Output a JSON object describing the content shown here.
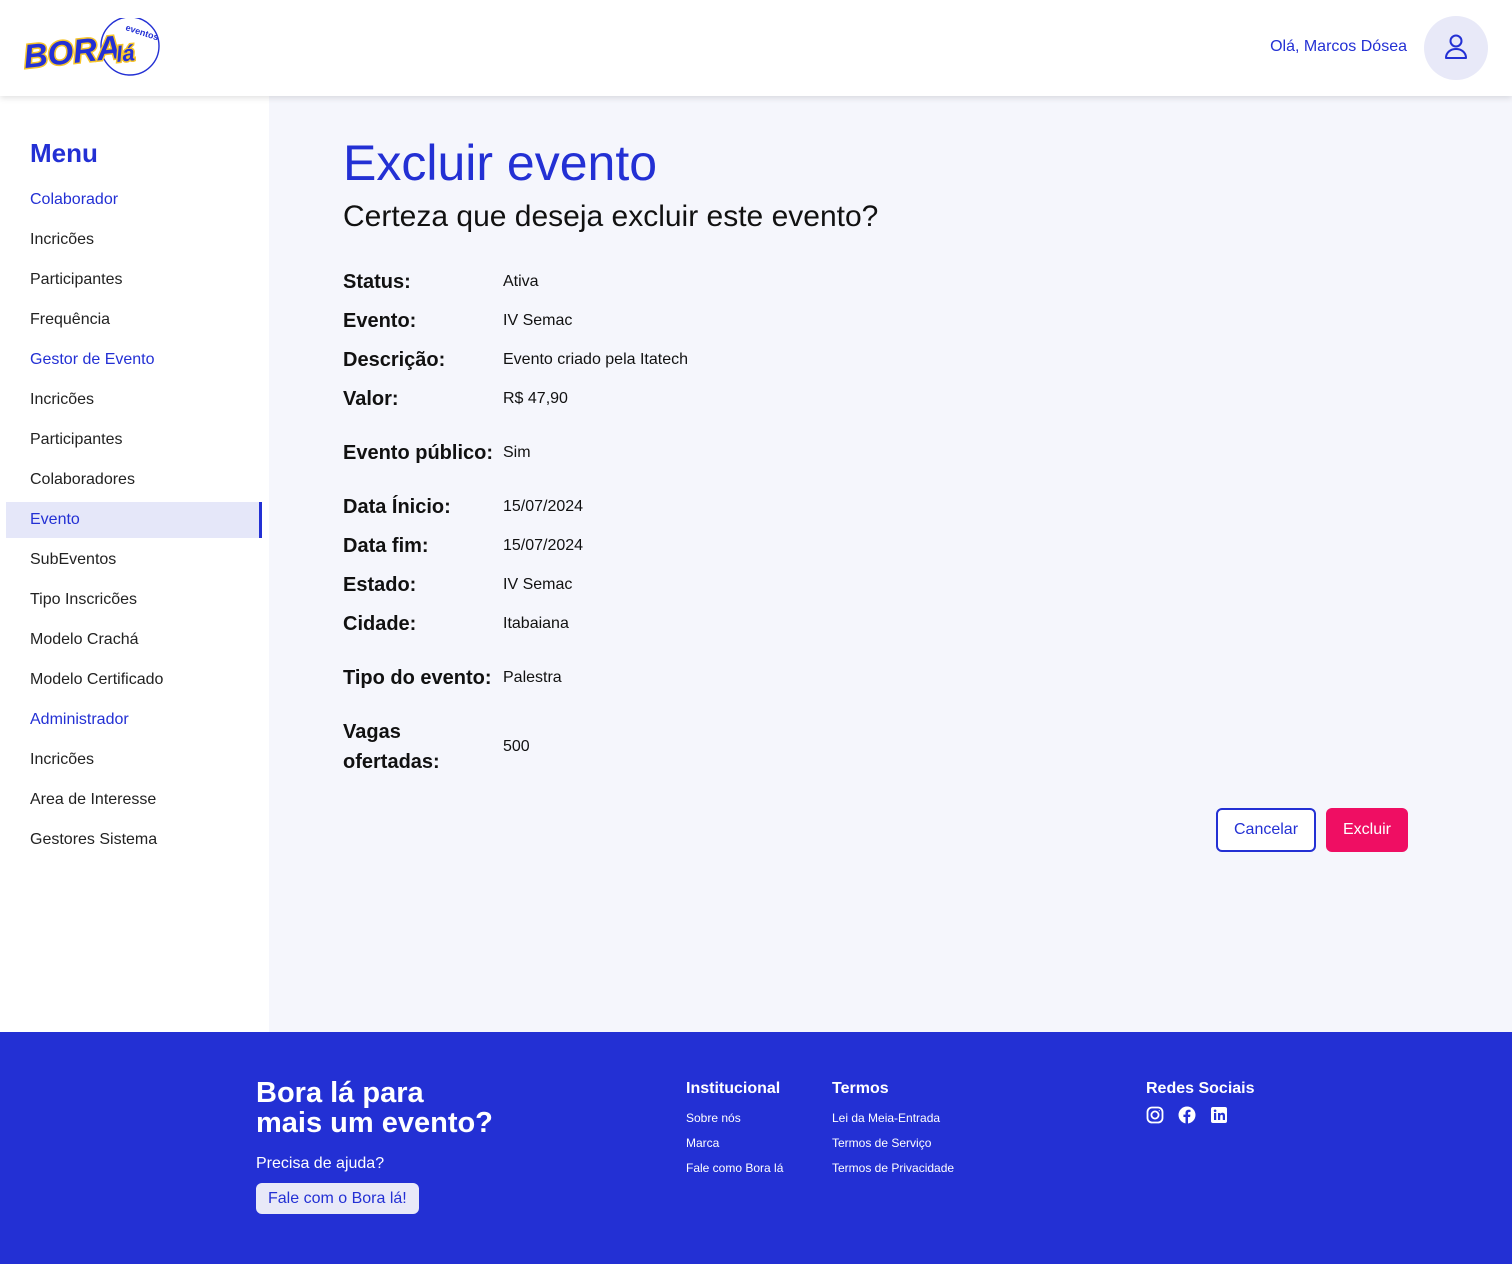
{
  "header": {
    "logo_main": "BORA",
    "logo_accent": "lá",
    "logo_tag": "eventos",
    "greeting": "Olá, Marcos Dósea"
  },
  "sidebar": {
    "title": "Menu",
    "items": [
      {
        "label": "Colaborador",
        "type": "section"
      },
      {
        "label": "Incricões",
        "type": "link"
      },
      {
        "label": "Participantes",
        "type": "link"
      },
      {
        "label": "Frequência",
        "type": "link"
      },
      {
        "label": "Gestor de Evento",
        "type": "section"
      },
      {
        "label": "Incricões",
        "type": "link"
      },
      {
        "label": "Participantes",
        "type": "link"
      },
      {
        "label": "Colaboradores",
        "type": "link"
      },
      {
        "label": "Evento",
        "type": "active"
      },
      {
        "label": "SubEventos",
        "type": "link"
      },
      {
        "label": "Tipo Inscricões",
        "type": "link"
      },
      {
        "label": "Modelo Crachá",
        "type": "link"
      },
      {
        "label": "Modelo Certificado",
        "type": "link"
      },
      {
        "label": "Administrador",
        "type": "section"
      },
      {
        "label": "Incricões",
        "type": "link"
      },
      {
        "label": "Area de Interesse",
        "type": "link"
      },
      {
        "label": "Gestores Sistema",
        "type": "link"
      }
    ]
  },
  "main": {
    "title": "Excluir evento",
    "subtitle": "Certeza que deseja excluir este evento?",
    "details": [
      {
        "label": "Status:",
        "value": "Ativa"
      },
      {
        "label": "Evento:",
        "value": "IV Semac"
      },
      {
        "label": "Descrição:",
        "value": "Evento criado pela Itatech"
      },
      {
        "label": "Valor:",
        "value": "R$ 47,90"
      },
      {
        "label": "Evento público:",
        "value": "Sim"
      },
      {
        "label": "Data Ínicio:",
        "value": "15/07/2024"
      },
      {
        "label": "Data fim:",
        "value": "15/07/2024"
      },
      {
        "label": "Estado:",
        "value": "IV Semac"
      },
      {
        "label": "Cidade:",
        "value": "Itabaiana"
      },
      {
        "label": "Tipo do evento:",
        "value": "Palestra"
      },
      {
        "label": "Vagas ofertadas:",
        "value": "500"
      }
    ],
    "cancel_label": "Cancelar",
    "delete_label": "Excluir"
  },
  "footer": {
    "headline_line1": "Bora lá para",
    "headline_line2": "mais um evento?",
    "help_text": "Precisa de ajuda?",
    "help_button": "Fale com o Bora lá!",
    "institucional": {
      "title": "Institucional",
      "links": [
        "Sobre nós",
        "Marca",
        "Fale como Bora lá"
      ]
    },
    "termos": {
      "title": "Termos",
      "links": [
        "Lei da Meia-Entrada",
        "Termos de Serviço",
        "Termos de Privacidade"
      ]
    },
    "social": {
      "title": "Redes Sociais",
      "icons": [
        "instagram-icon",
        "facebook-icon",
        "linkedin-icon"
      ]
    }
  },
  "colors": {
    "brand_blue": "#2330d4",
    "danger_pink": "#ef0e63",
    "logo_yellow": "#f7c52a",
    "main_bg": "#f5f6fc",
    "active_bg": "#e5e7f9"
  }
}
